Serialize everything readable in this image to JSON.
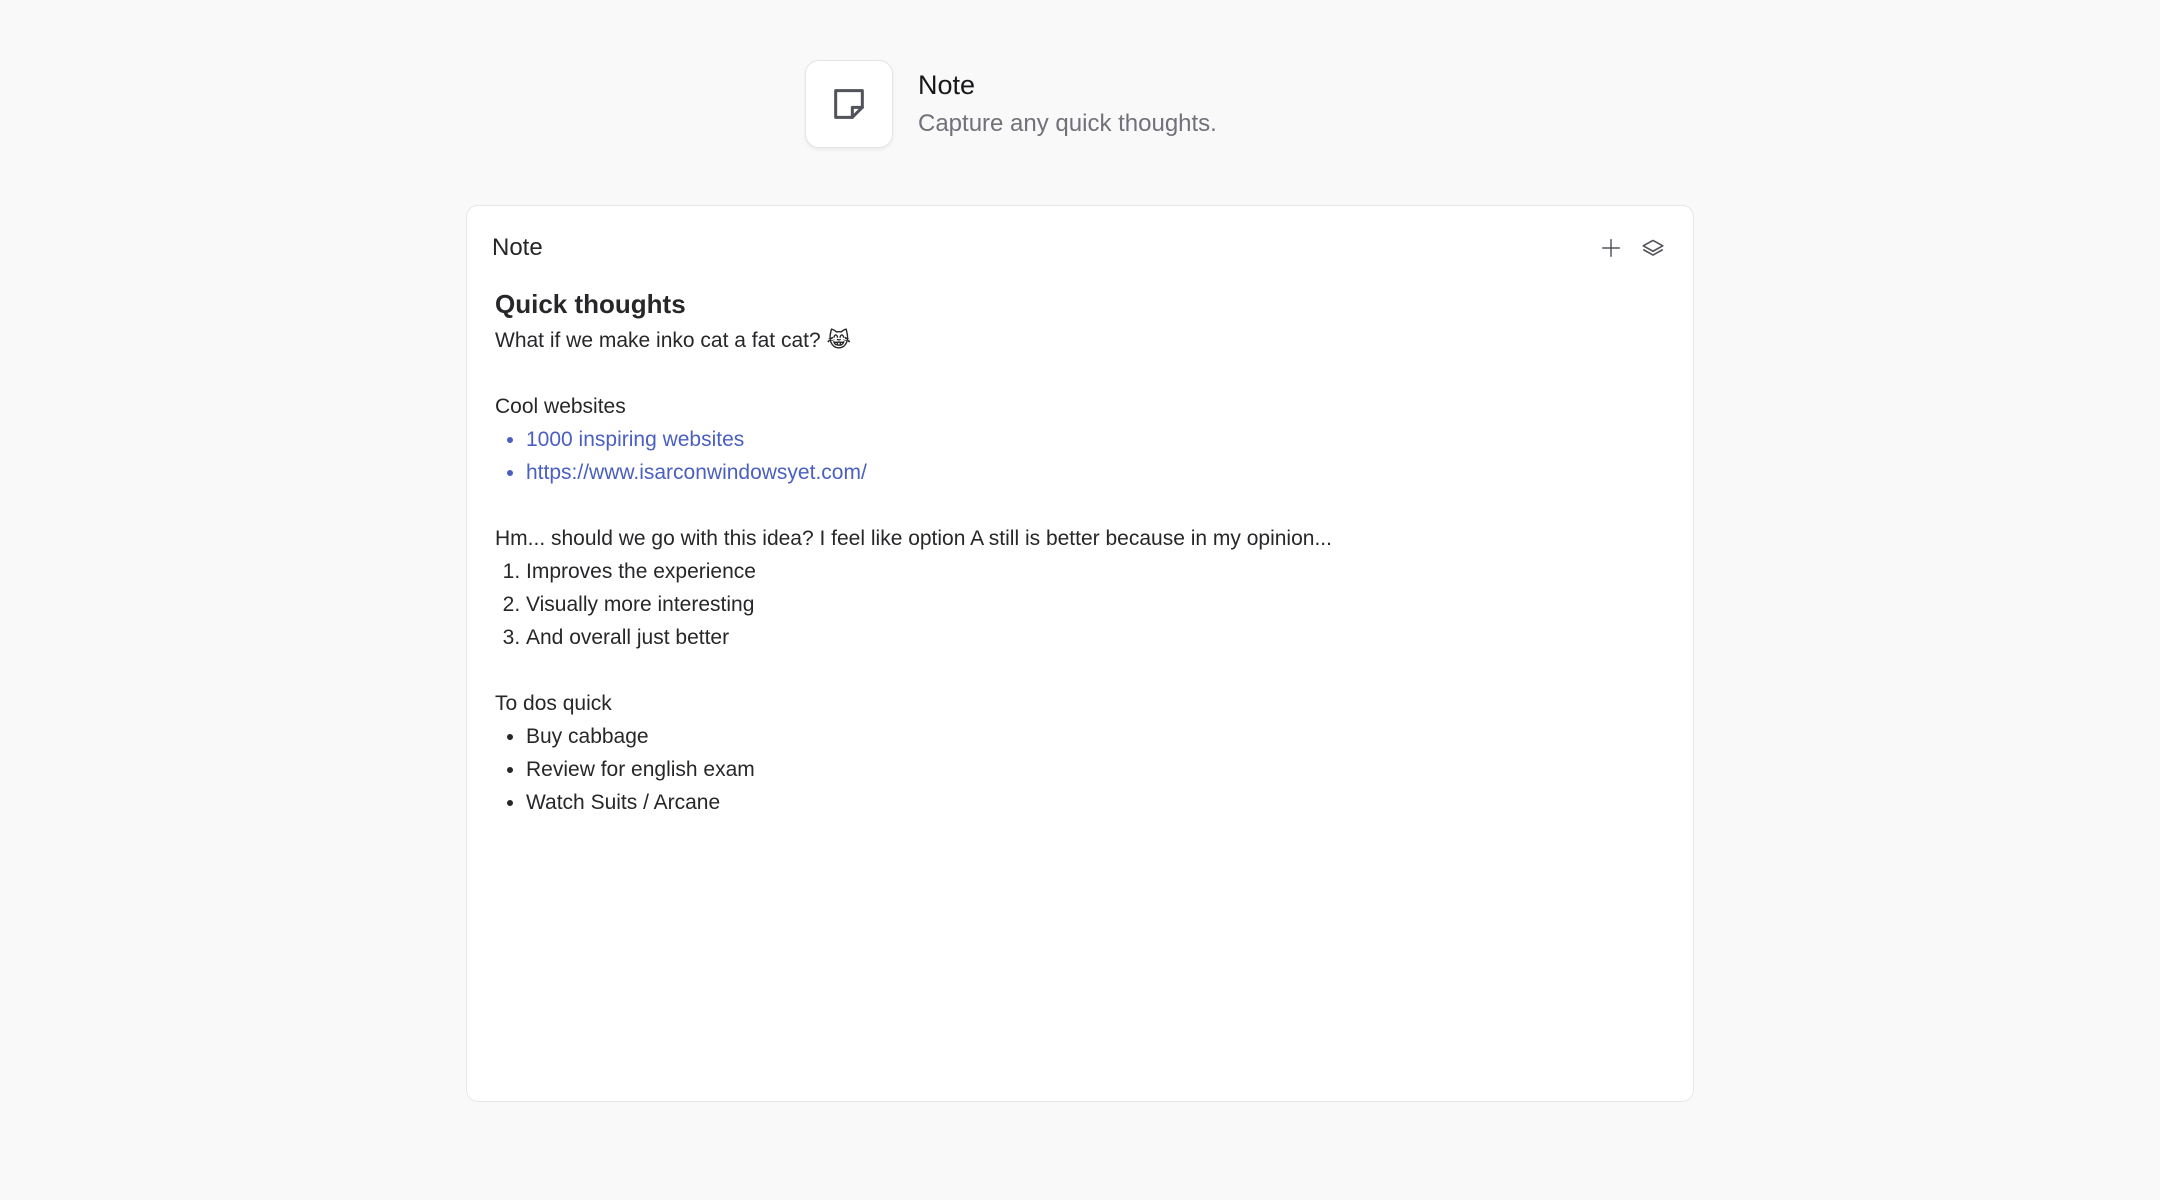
{
  "header": {
    "title": "Note",
    "subtitle": "Capture any quick thoughts."
  },
  "card": {
    "title": "Note",
    "icons": [
      "plus-icon",
      "layers-icon"
    ]
  },
  "note": {
    "heading": "Quick thoughts",
    "intro": "What if we make inko cat a fat cat? 😹",
    "links_label": "Cool websites",
    "links": [
      "1000 inspiring websites",
      "https://www.isarconwindowsyet.com/"
    ],
    "idea_text": "Hm... should we go with this idea? I feel like option A still is better because in my opinion...",
    "reasons": [
      "Improves the experience",
      "Visually more interesting",
      "And overall just better"
    ],
    "todos_label": "To dos quick",
    "todos": [
      "Buy cabbage",
      "Review for english exam",
      "Watch Suits / Arcane"
    ]
  },
  "colors": {
    "background": "#f9f9f9",
    "link": "#4a5fc1",
    "text": "#27272a",
    "muted": "#71717a"
  }
}
